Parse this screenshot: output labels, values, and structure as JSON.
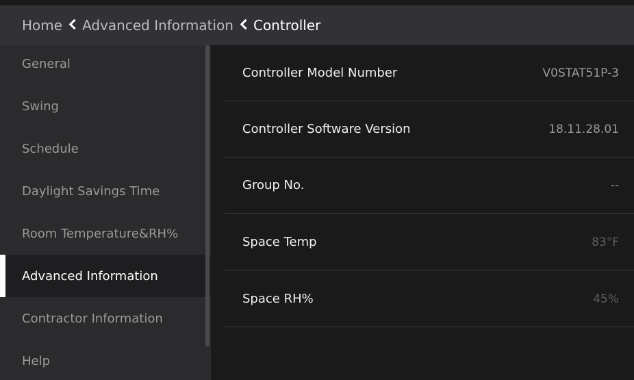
{
  "breadcrumb": {
    "home": "Home",
    "advanced": "Advanced Information",
    "current": "Controller"
  },
  "sidebar": {
    "items": [
      {
        "label": "General"
      },
      {
        "label": "Swing"
      },
      {
        "label": "Schedule"
      },
      {
        "label": "Daylight Savings Time"
      },
      {
        "label": "Room Temperature&RH%"
      },
      {
        "label": "Advanced Information"
      },
      {
        "label": "Contractor Information"
      },
      {
        "label": "Help"
      }
    ],
    "active_index": 5
  },
  "details": [
    {
      "label": "Controller Model Number",
      "value": "V0STAT51P-3"
    },
    {
      "label": "Controller Software Version",
      "value": "18.11.28.01"
    },
    {
      "label": "Group No.",
      "value": "--"
    },
    {
      "label": "Space Temp",
      "value": "83°F"
    },
    {
      "label": "Space RH%",
      "value": "45%"
    }
  ],
  "colors": {
    "header_bg": "#323236",
    "sidebar_bg": "#2b2b2e",
    "main_bg": "#1a1a1a",
    "active_indicator": "#ffffff"
  }
}
